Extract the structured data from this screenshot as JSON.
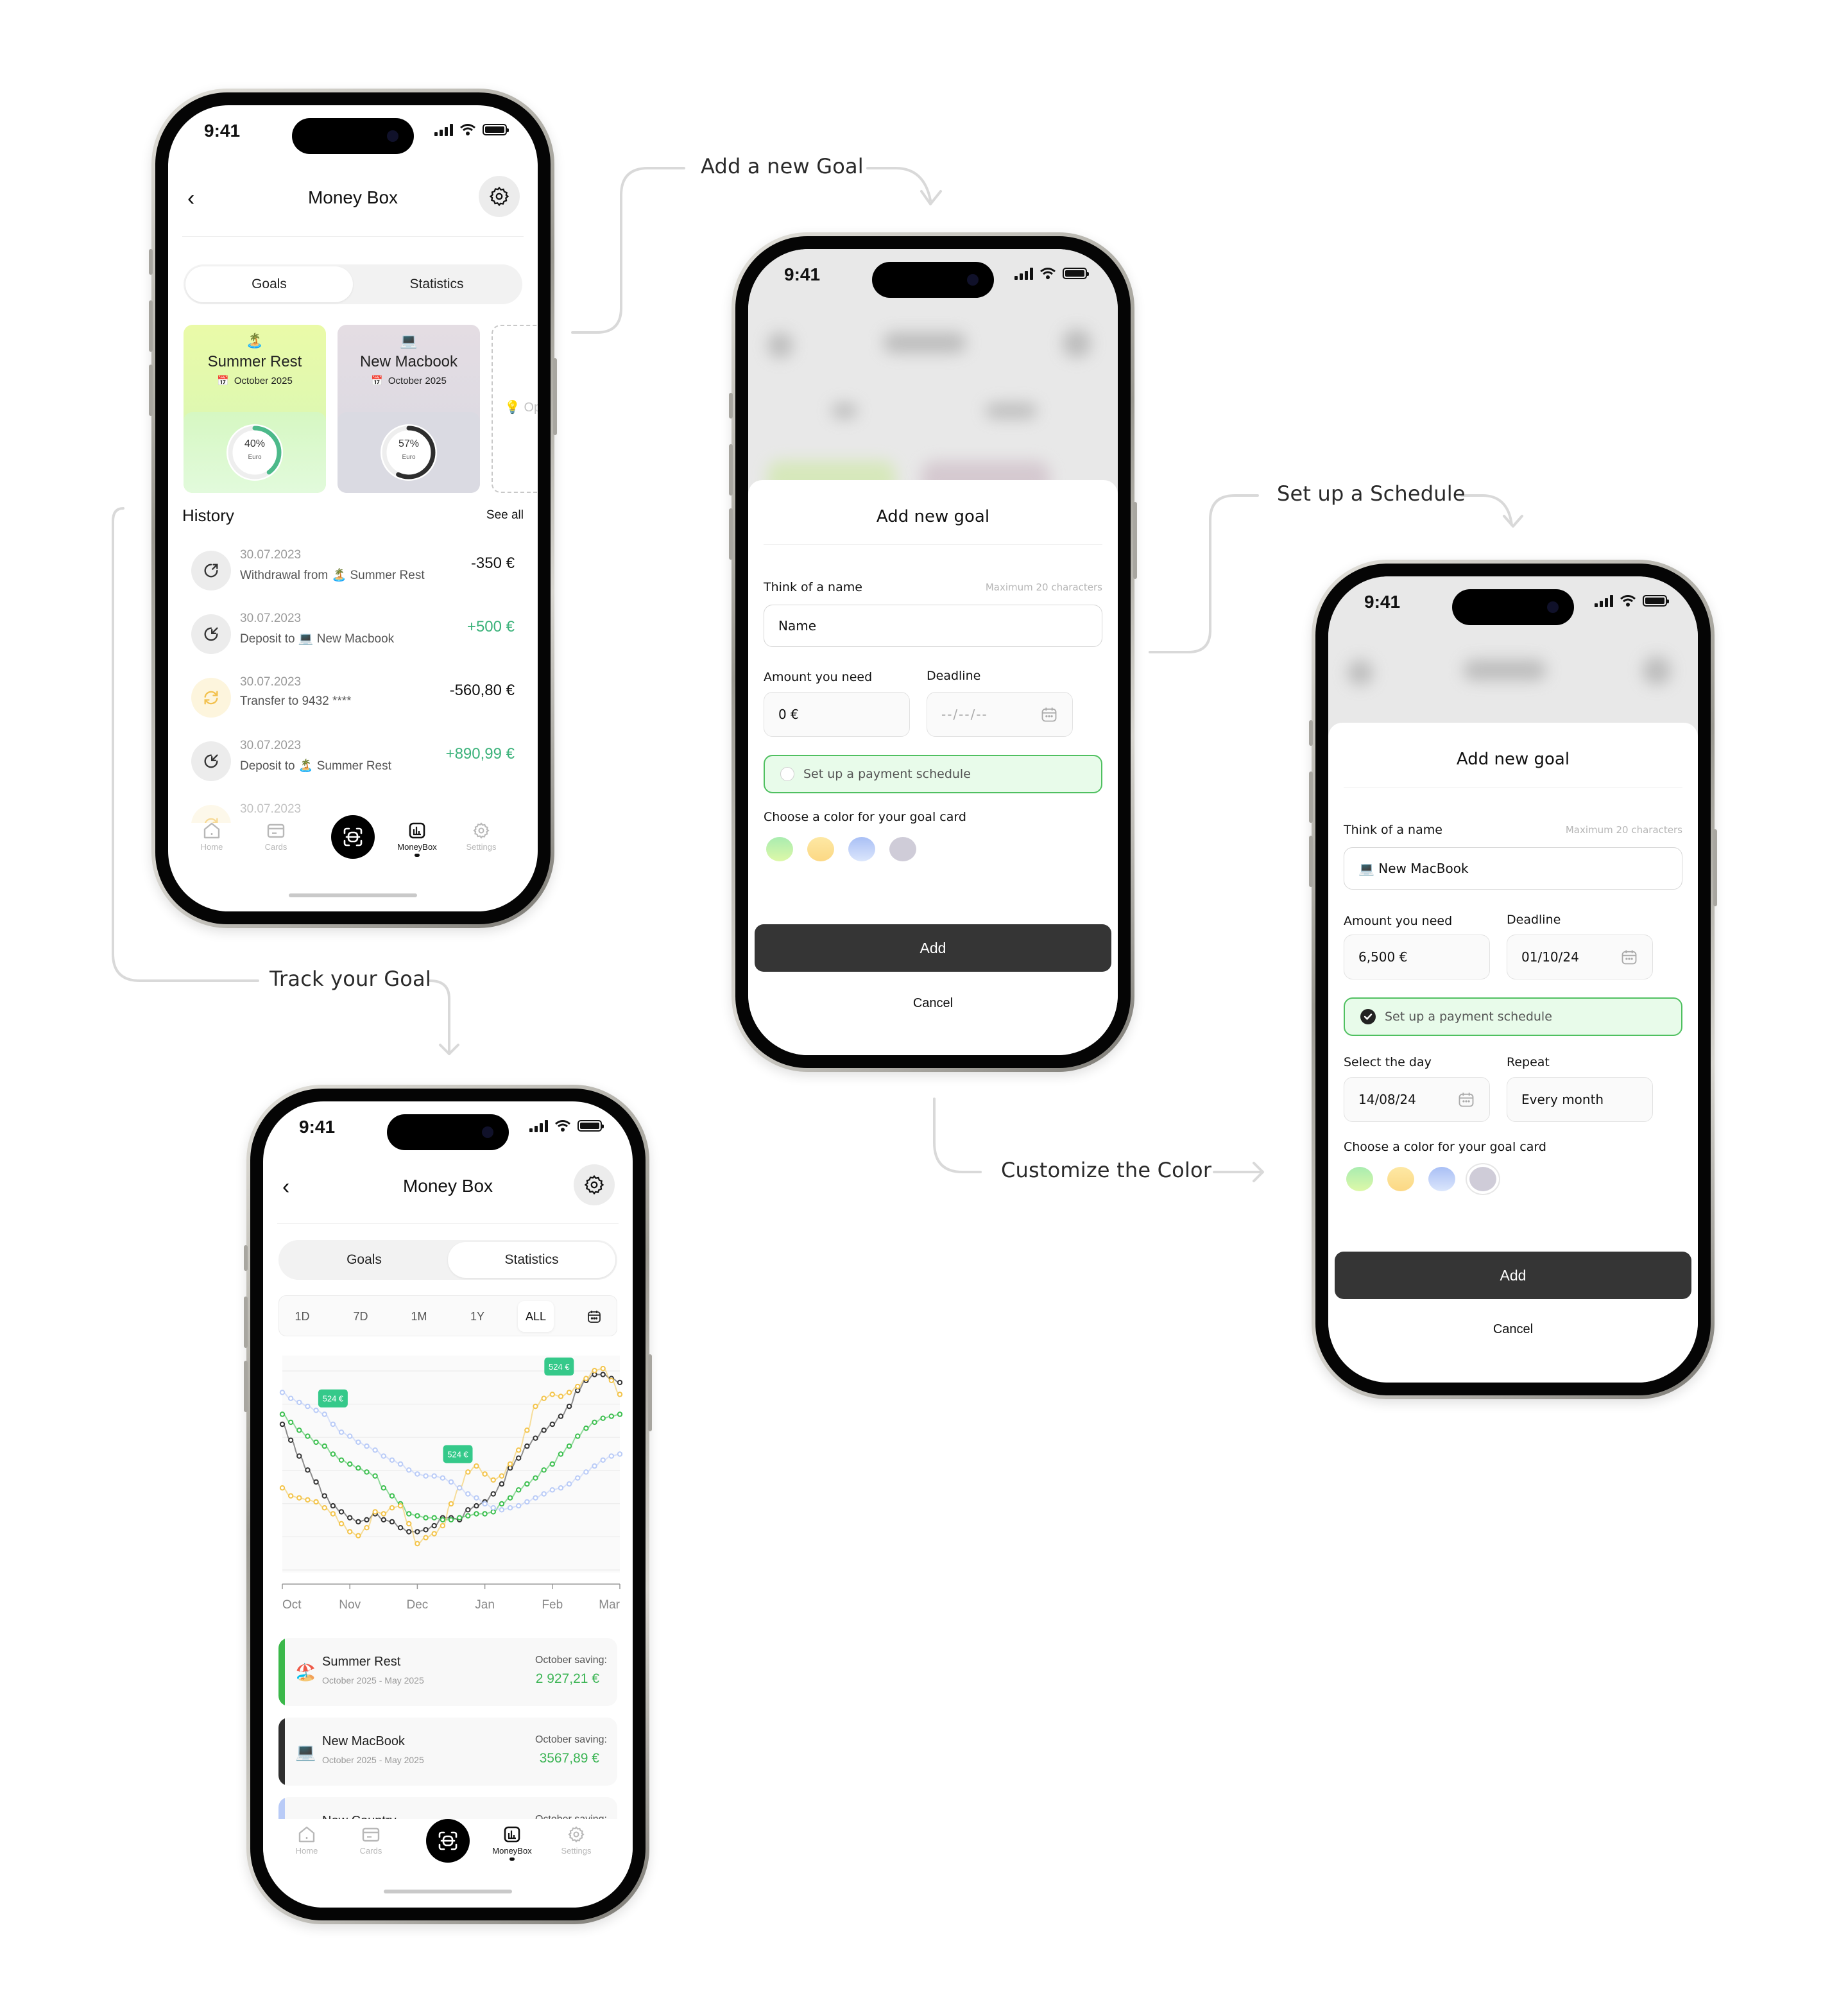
{
  "flow_labels": {
    "add_goal": "Add a new Goal",
    "schedule": "Set up a Schedule",
    "track": "Track your Goal",
    "color": "Customize the Color"
  },
  "status_bar": {
    "time": "9:41"
  },
  "colors": {
    "positive": "#3bb27a",
    "schedule_border": "#4fc060",
    "schedule_bg": "#e8fbea",
    "add_button": "#353535",
    "series_black": "#333333",
    "series_green": "#3cbf4f",
    "series_yellow": "#f3c44a",
    "series_blue": "#b9cbf7",
    "label_badge": "#35c98a"
  },
  "goals_screen": {
    "title": "Money Box",
    "segments": [
      "Goals",
      "Statistics"
    ],
    "active_segment": "Goals",
    "goal_cards": [
      {
        "emoji": "🏝️",
        "name": "Summer Rest",
        "date": "October 2025",
        "progress_label": "40%",
        "progress": 0.4,
        "unit": "Euro",
        "ring_color": "#4cb98a"
      },
      {
        "emoji": "💻",
        "name": "New Macbook",
        "date": "October 2025",
        "progress_label": "57%",
        "progress": 0.57,
        "unit": "Euro",
        "ring_color": "#2e2e2e"
      }
    ],
    "new_card_hint": "💡 Op",
    "history_title": "History",
    "see_all": "See all",
    "history": [
      {
        "icon": "withdraw-icon",
        "date": "30.07.2023",
        "desc": "Withdrawal from 🏝️ Summer Rest",
        "amount": "-350 €",
        "positive": false
      },
      {
        "icon": "deposit-icon",
        "date": "30.07.2023",
        "desc": "Deposit to 💻 New Macbook",
        "amount": "+500 €",
        "positive": true
      },
      {
        "icon": "transfer-icon",
        "date": "30.07.2023",
        "desc": "Transfer to 9432 ****",
        "amount": "-560,80 €",
        "positive": false
      },
      {
        "icon": "deposit-icon",
        "date": "30.07.2023",
        "desc": "Deposit to 🏝️ Summer Rest",
        "amount": "+890,99 €",
        "positive": true
      },
      {
        "icon": "transfer-icon",
        "date": "30.07.2023",
        "desc": "",
        "amount": "",
        "positive": false
      }
    ]
  },
  "tabbar": {
    "items": [
      {
        "label": "Home",
        "icon": "home-icon"
      },
      {
        "label": "Cards",
        "icon": "card-icon"
      },
      {
        "label": "",
        "icon": "scan-icon"
      },
      {
        "label": "MoneyBox",
        "icon": "moneybox-icon",
        "active": true
      },
      {
        "label": "Settings",
        "icon": "settings-icon"
      }
    ]
  },
  "add_goal_empty": {
    "title": "Add new goal",
    "name_label": "Think of a name",
    "name_hint": "Maximum 20 characters",
    "name_placeholder": "Name",
    "amount_label": "Amount you need",
    "amount_value": "0 €",
    "deadline_label": "Deadline",
    "deadline_placeholder": "--/--/--",
    "schedule_label": "Set up a payment schedule",
    "schedule_checked": false,
    "color_label": "Choose a color for your goal card",
    "swatches": [
      "green",
      "yellow",
      "blue",
      "gray"
    ],
    "add": "Add",
    "cancel": "Cancel"
  },
  "add_goal_filled": {
    "title": "Add new goal",
    "name_label": "Think of a name",
    "name_hint": "Maximum 20 characters",
    "name_value": "💻  New MacBook",
    "amount_label": "Amount you need",
    "amount_value": "6,500 €",
    "deadline_label": "Deadline",
    "deadline_value": "01/10/24",
    "schedule_label": "Set up a payment schedule",
    "schedule_checked": true,
    "day_label": "Select the day",
    "day_value": "14/08/24",
    "repeat_label": "Repeat",
    "repeat_value": "Every month",
    "color_label": "Choose a color for your goal card",
    "swatches": [
      "green",
      "yellow",
      "blue",
      "gray"
    ],
    "selected_swatch": "gray",
    "add": "Add",
    "cancel": "Cancel"
  },
  "stats_screen": {
    "title": "Money Box",
    "segments": [
      "Goals",
      "Statistics"
    ],
    "active_segment": "Statistics",
    "periods": [
      "1D",
      "7D",
      "1M",
      "1Y",
      "ALL"
    ],
    "active_period": "ALL",
    "savings": [
      {
        "emoji": "🏖️",
        "name": "Summer Rest",
        "range": "October 2025 - May 2025",
        "label": "October saving:",
        "value": "2 927,21 €",
        "bar_color": "#3bb84a"
      },
      {
        "emoji": "💻",
        "name": "New MacBook",
        "range": "October 2025 - May 2025",
        "label": "October saving:",
        "value": "3567,89 €",
        "bar_color": "#2e2e2e"
      },
      {
        "emoji": "🌏",
        "name": "New Country",
        "range": "",
        "label": "October saving:",
        "value": "",
        "bar_color": "#b9cbf7"
      }
    ]
  },
  "chart_data": {
    "type": "line",
    "title": "",
    "xlabel": "",
    "ylabel": "",
    "x_ticks": [
      "Oct",
      "Nov",
      "Dec",
      "Jan",
      "Feb",
      "Mar"
    ],
    "x_range": [
      0,
      5
    ],
    "ylim": [
      0,
      100
    ],
    "grid": true,
    "legend": "none",
    "annotations": [
      {
        "text": "524 €",
        "x": 0.75,
        "y": 83
      },
      {
        "text": "524 €",
        "x": 2.6,
        "y": 55
      },
      {
        "text": "524 €",
        "x": 4.1,
        "y": 99
      }
    ],
    "series": [
      {
        "name": "black",
        "color": "#333333",
        "x": [
          0,
          0.125,
          0.25,
          0.375,
          0.5,
          0.625,
          0.75,
          0.875,
          1,
          1.125,
          1.25,
          1.375,
          1.5,
          1.625,
          1.75,
          1.875,
          2,
          2.125,
          2.25,
          2.375,
          2.5,
          2.625,
          2.75,
          2.875,
          3,
          3.125,
          3.25,
          3.375,
          3.5,
          3.625,
          3.75,
          3.875,
          4,
          4.125,
          4.25,
          4.375,
          4.5,
          4.625,
          4.75,
          4.875,
          5
        ],
        "values": [
          70,
          62,
          54,
          47,
          41,
          34,
          29,
          26,
          23,
          21,
          22,
          25,
          22,
          21,
          18,
          16,
          16,
          17,
          19,
          23,
          23,
          22,
          27,
          29,
          31,
          35,
          40,
          48,
          53,
          59,
          63,
          67,
          70,
          74,
          79,
          87,
          92,
          95,
          95,
          93,
          91
        ]
      },
      {
        "name": "green",
        "color": "#3cbf4f",
        "x": [
          0,
          0.125,
          0.25,
          0.375,
          0.5,
          0.625,
          0.75,
          0.875,
          1,
          1.125,
          1.25,
          1.375,
          1.5,
          1.625,
          1.75,
          1.875,
          2,
          2.125,
          2.25,
          2.375,
          2.5,
          2.625,
          2.75,
          2.875,
          3,
          3.125,
          3.25,
          3.375,
          3.5,
          3.625,
          3.75,
          3.875,
          4,
          4.125,
          4.25,
          4.375,
          4.5,
          4.625,
          4.75,
          4.875,
          5
        ],
        "values": [
          75,
          71,
          67,
          64,
          61,
          59,
          55,
          52,
          50,
          48,
          46,
          44,
          38,
          34,
          30,
          25,
          24,
          23,
          23,
          22,
          22,
          23,
          24,
          25,
          25,
          26,
          30,
          33,
          37,
          40,
          43,
          47,
          50,
          55,
          59,
          64,
          68,
          71,
          73,
          74,
          75
        ]
      },
      {
        "name": "yellow",
        "color": "#f3c44a",
        "x": [
          0,
          0.125,
          0.25,
          0.375,
          0.5,
          0.625,
          0.75,
          0.875,
          1,
          1.125,
          1.25,
          1.375,
          1.5,
          1.625,
          1.75,
          1.875,
          2,
          2.125,
          2.25,
          2.375,
          2.5,
          2.625,
          2.75,
          2.875,
          3,
          3.125,
          3.25,
          3.375,
          3.5,
          3.625,
          3.75,
          3.875,
          4,
          4.125,
          4.25,
          4.375,
          4.5,
          4.625,
          4.75,
          4.875,
          5
        ],
        "values": [
          38,
          34,
          33,
          32,
          31,
          28,
          25,
          20,
          16,
          14,
          18,
          26,
          25,
          28,
          29,
          20,
          10,
          13,
          15,
          19,
          30,
          38,
          46,
          49,
          45,
          42,
          44,
          50,
          57,
          67,
          79,
          83,
          85,
          84,
          86,
          89,
          93,
          97,
          98,
          92,
          85
        ]
      },
      {
        "name": "blue",
        "color": "#b9cbf7",
        "x": [
          0,
          0.125,
          0.25,
          0.375,
          0.5,
          0.625,
          0.75,
          0.875,
          1,
          1.125,
          1.25,
          1.375,
          1.5,
          1.625,
          1.75,
          1.875,
          2,
          2.125,
          2.25,
          2.375,
          2.5,
          2.625,
          2.75,
          2.875,
          3,
          3.125,
          3.25,
          3.375,
          3.5,
          3.625,
          3.75,
          3.875,
          4,
          4.125,
          4.25,
          4.375,
          4.5,
          4.625,
          4.75,
          4.875,
          5
        ],
        "values": [
          86,
          83,
          81,
          79,
          77,
          75,
          70,
          66,
          64,
          61,
          59,
          57,
          54,
          52,
          50,
          47,
          45,
          44,
          44,
          43,
          41,
          38,
          35,
          33,
          30,
          28,
          27,
          28,
          29,
          31,
          33,
          35,
          37,
          38,
          40,
          43,
          46,
          49,
          52,
          54,
          55
        ]
      }
    ]
  }
}
